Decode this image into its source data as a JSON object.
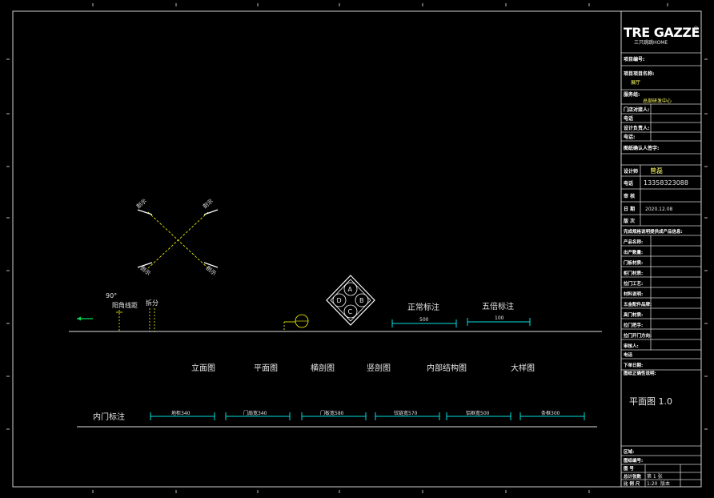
{
  "title_block": {
    "brand": "TRE GAZZE",
    "brand_sub": "三只跳跳HOME",
    "registered_mark": "®",
    "project_label": "项目编号:",
    "project_name_label": "项目项目名称:",
    "project_name_value": "展厅",
    "service_label": "服务组:",
    "service_value": "总部研发中心",
    "sales_label": "门店对接人:",
    "sales_phone_label": "电话",
    "design_manager_label": "设计负责人:",
    "design_manager_phone_label": "电话:",
    "approve_label": "图纸确认人签字:",
    "designer_label": "设计师",
    "designer_value": "曾磊",
    "phone_label": "电话",
    "phone_value": "13358323088",
    "review_label": "审 核",
    "date_label": "日 期",
    "date_value": "2020.12.08",
    "revision_label": "版 次",
    "product_header": "完成规格说明提供成产品信息:",
    "product_rows": [
      "产品名称:",
      "出产数量:",
      "门板材质:",
      "柜门材质:",
      "拉门工艺:",
      "材料说明:",
      "五金配件品牌:",
      "高门材质:",
      "拉门把手:",
      "拉门开门方向:",
      "审核人:",
      "电话",
      "下单日期:",
      "图纸正确性说明:"
    ],
    "drawing_title": "平面图 1.0",
    "bottom_rows": [
      "区域:",
      "图纸编号:",
      "图 号"
    ],
    "sheet_label": "总计张数",
    "sheet_value": "第 1 张",
    "scale_label": "比 例 尺",
    "scale_value": "1:20",
    "version_value": "版本"
  },
  "symbols": {
    "angle_value": "90°",
    "angle_label": "阳角线距",
    "split_label": "拆分",
    "normal_dim_label": "正常标注",
    "normal_dim_value": "500",
    "five_dim_label": "五倍标注",
    "five_dim_value": "100",
    "hex_letters": [
      "A",
      "B",
      "C",
      "D"
    ],
    "cross_labels": [
      "剖示",
      "剖示",
      "剖示",
      "剖示"
    ]
  },
  "views": [
    "立面图",
    "平面图",
    "横剖图",
    "竖剖图",
    "内部结构图",
    "大样图"
  ],
  "inner_dims": {
    "label": "内门标注",
    "items": [
      "地柜340",
      "门扇宽340",
      "门板宽580",
      "铰链宽570",
      "铝框宽500",
      "条框300"
    ]
  }
}
